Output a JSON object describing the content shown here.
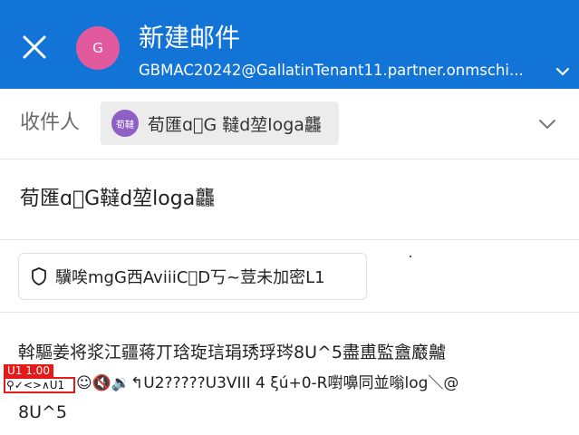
{
  "header": {
    "title": "新建邮件",
    "account": "GBMAC20242@GallatinTenant11.partner.onmschi...",
    "avatar_letter": "G",
    "avatar_color": "#e25a9e",
    "background_color": "#1274d6",
    "close_icon": "close-icon",
    "account_chevron_icon": "chevron-down-icon"
  },
  "to": {
    "label": "收件人",
    "chip_avatar": "荀韃",
    "chip_name": "荀匯ɑ\u0000G 韃d堃loga龘",
    "chevron_icon": "chevron-down-icon"
  },
  "subject": {
    "value": "荀匯ɑ\u0000G韃d堃loga龘"
  },
  "sensitivity": {
    "icon": "shield-icon",
    "label": "驥唉mgG西AviiiC\u0000D丂~荳未加密L1"
  },
  "body": {
    "line1": "斡驅姜将浆江疆蒋丌琀琁琂琄琇琈琌8U^5盡盙監盦黀齇",
    "line2": "☺🔇🔉↰U2?????U3VIII 4 ξú+0-R嚉嚊同並嗡log＼@",
    "line3": "8U^5"
  },
  "debug_overlay": {
    "tag": "U1 1.00",
    "content": "⚲✓<>∧U1"
  }
}
